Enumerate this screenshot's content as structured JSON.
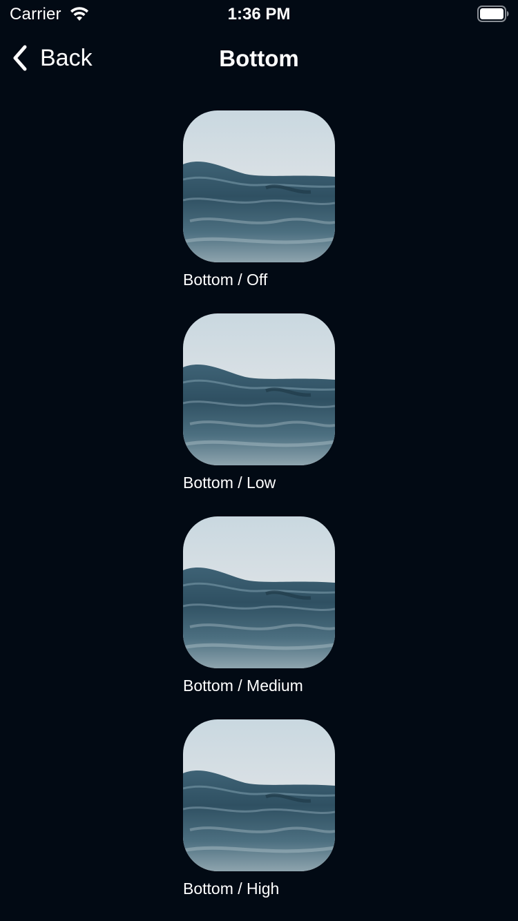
{
  "status_bar": {
    "carrier": "Carrier",
    "time": "1:36 PM",
    "wifi_icon": "wifi-icon",
    "battery_icon": "battery-icon"
  },
  "nav": {
    "back_label": "Back",
    "back_icon": "chevron-left-icon",
    "title": "Bottom"
  },
  "items": [
    {
      "label": "Bottom / Off"
    },
    {
      "label": "Bottom / Low"
    },
    {
      "label": "Bottom / Medium"
    },
    {
      "label": "Bottom / High"
    }
  ],
  "colors": {
    "background": "#020a14",
    "text": "#ffffff"
  }
}
